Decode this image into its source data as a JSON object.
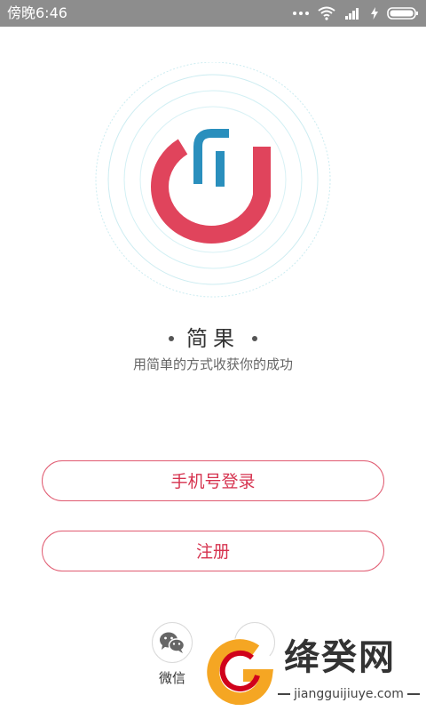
{
  "status_bar": {
    "time": "傍晚6:46",
    "icons": [
      "more-dots-icon",
      "wifi-icon",
      "signal-icon",
      "charging-icon",
      "battery-icon"
    ]
  },
  "app": {
    "name": "简果",
    "tagline": "用简单的方式收获你的成功"
  },
  "buttons": {
    "phone_login": "手机号登录",
    "register": "注册"
  },
  "social": {
    "wechat_label": "微信"
  },
  "watermark": {
    "text": "绛癸网",
    "url": "jiangguijiuye.com"
  },
  "colors": {
    "status_bar": "#8d8d8d",
    "accent_red": "#e0445c",
    "accent_blue": "#2a8fbd",
    "ring": "#bfe7ee",
    "button_border": "#e05a70",
    "button_text": "#d6334f",
    "watermark_orange": "#f5a623"
  }
}
